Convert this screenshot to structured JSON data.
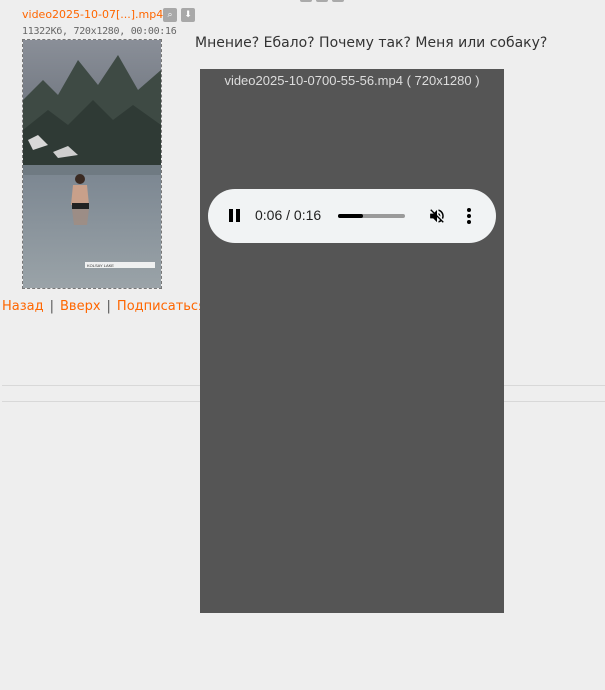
{
  "file": {
    "name": "video2025-10-07[...].mp4",
    "info": "11322Кб, 720x1280, 00:00:16",
    "search_icon": "search-icon",
    "download_icon": "download-icon",
    "thumbnail_caption": "KOLSAY LAKE"
  },
  "post": {
    "text": "Мнение? Ебало? Почему так? Меня или собаку?"
  },
  "nav": {
    "back": "Назад",
    "top": "Вверх",
    "subscribe": "Подписаться",
    "separator": "|"
  },
  "player": {
    "title": "video2025-10-0700-55-56.mp4 ( 720x1280 )",
    "time": "0:06 / 0:16",
    "progress": 0.375,
    "pause_icon": "pause-icon",
    "mute_icon": "volume-muted-icon",
    "more_icon": "more-vert-icon"
  },
  "colors": {
    "link": "#ff6600",
    "background": "#eeeeee",
    "player_bg": "#555555",
    "controls_bg": "#f1f3f4"
  }
}
